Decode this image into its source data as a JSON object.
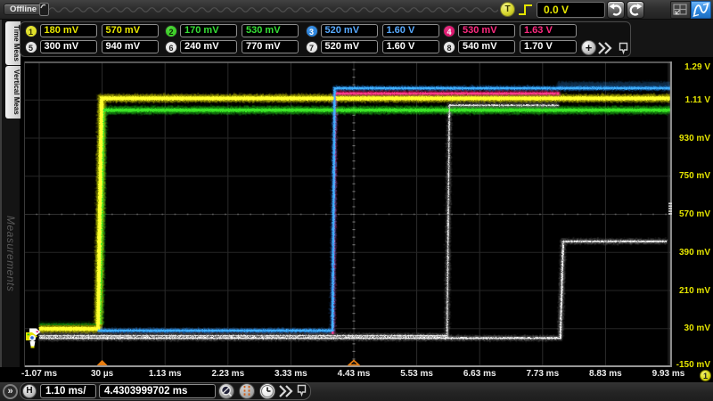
{
  "topbar": {
    "offline_label": "Offline",
    "trigger_letter": "T",
    "trigger_level": "0.0 V"
  },
  "sidebar": {
    "tabs": [
      "Time Meas",
      "Vertical Meas"
    ],
    "watermark": "Measurements"
  },
  "measurements": {
    "rows": [
      [
        {
          "channel": "1",
          "badge_bg": "#e0e02a",
          "badge_fg": "#333300",
          "text_color": "#e8e800",
          "values": [
            "180 mV",
            "570 mV"
          ]
        },
        {
          "channel": "2",
          "badge_bg": "#3fd02a",
          "badge_fg": "#0b2a00",
          "text_color": "#35e035",
          "values": [
            "170 mV",
            "530 mV"
          ]
        },
        {
          "channel": "3",
          "badge_bg": "#2e86dd",
          "badge_fg": "#ffffff",
          "text_color": "#57aaff",
          "values": [
            "520 mV",
            "1.60 V"
          ]
        },
        {
          "channel": "4",
          "badge_bg": "#e01a72",
          "badge_fg": "#ffffff",
          "text_color": "#ff2a80",
          "values": [
            "530 mV",
            "1.63 V"
          ]
        }
      ],
      [
        {
          "channel": "5",
          "badge_bg": "#e6e6e6",
          "badge_fg": "#222222",
          "text_color": "#ffffff",
          "values": [
            "300 mV",
            "940 mV"
          ]
        },
        {
          "channel": "6",
          "badge_bg": "#e6e6e6",
          "badge_fg": "#222222",
          "text_color": "#ffffff",
          "values": [
            "240 mV",
            "770 mV"
          ]
        },
        {
          "channel": "7",
          "badge_bg": "#e6e6e6",
          "badge_fg": "#222222",
          "text_color": "#ffffff",
          "values": [
            "520 mV",
            "1.60 V"
          ]
        },
        {
          "channel": "8",
          "badge_bg": "#e6e6e6",
          "badge_fg": "#222222",
          "text_color": "#ffffff",
          "values": [
            "540 mV",
            "1.70 V"
          ]
        }
      ]
    ],
    "add_label": "+"
  },
  "hbar": {
    "h_label": "H",
    "scale": "1.10 ms/",
    "position": "4.4303999702 ms",
    "expand_glyph": "»"
  },
  "sidebar_expand_glyph": "»",
  "axis_badge": "1",
  "chart_data": {
    "type": "line",
    "title": "",
    "x_unit": "ms",
    "y_unit": "V",
    "x_ticks": [
      "-1.07 ms",
      "30 µs",
      "1.13 ms",
      "2.23 ms",
      "3.33 ms",
      "4.43 ms",
      "5.53 ms",
      "6.63 ms",
      "7.73 ms",
      "8.83 ms",
      "9.93 ms"
    ],
    "x_tick_values": [
      -1.07,
      0.03,
      1.13,
      2.23,
      3.33,
      4.43,
      5.53,
      6.63,
      7.73,
      8.83,
      9.93
    ],
    "y_ticks": [
      "1.29 V",
      "1.11 V",
      "930 mV",
      "750 mV",
      "570 mV",
      "390 mV",
      "210 mV",
      "30 mV",
      "-150 mV"
    ],
    "y_tick_values": [
      1.29,
      1.11,
      0.93,
      0.75,
      0.57,
      0.39,
      0.21,
      0.03,
      -0.15
    ],
    "xlim": [
      -1.07,
      9.93
    ],
    "ylim": [
      -0.15,
      1.29
    ],
    "timebase_marker_time": 0.03,
    "delay_marker_time": 4.43,
    "traces": [
      {
        "name": "channel-2-baseline",
        "color": "#0a4a06",
        "core": "#107c0a",
        "halo_w": 5.5,
        "core_w": 1.4,
        "opacity": 0.5,
        "points": [
          [
            -1.07,
            0.05
          ],
          [
            -0.015,
            0.05
          ]
        ]
      },
      {
        "name": "channel-2",
        "color": "#18a812",
        "core": "#3ae526",
        "halo_w": 8.5,
        "core_w": 3.6,
        "opacity": 0.75,
        "points": [
          [
            -0.015,
            0.05
          ],
          [
            0.045,
            1.062
          ],
          [
            9.97,
            1.062
          ]
        ]
      },
      {
        "name": "channel-1",
        "color": "#b8b800",
        "core": "#ffff2e",
        "halo_w": 8.5,
        "core_w": 4.2,
        "opacity": 0.8,
        "points": [
          [
            -1.07,
            0.029
          ],
          [
            -0.04,
            0.029
          ],
          [
            0.02,
            1.118
          ],
          [
            9.97,
            1.118
          ]
        ]
      },
      {
        "name": "channel-white-a",
        "color": "#808080",
        "core": "#e8e8e8",
        "halo_w": 5.0,
        "core_w": 1.3,
        "opacity": 0.55,
        "points": [
          [
            -1.07,
            -0.004
          ],
          [
            6.06,
            -0.004
          ],
          [
            6.1,
            1.085
          ],
          [
            8.02,
            1.085
          ]
        ]
      },
      {
        "name": "channel-white-b",
        "color": "#848484",
        "core": "#f4f4f4",
        "halo_w": 5.5,
        "core_w": 1.8,
        "opacity": 0.6,
        "points": [
          [
            -1.07,
            -0.015
          ],
          [
            8.04,
            -0.015
          ],
          [
            8.09,
            0.442
          ],
          [
            9.9,
            0.442
          ]
        ]
      },
      {
        "name": "channel-4",
        "color": "#b8104f",
        "core": "#ff3d8e",
        "halo_w": 5.0,
        "core_w": 2.2,
        "opacity": 0.8,
        "points": [
          [
            4.062,
            0.005
          ],
          [
            4.1,
            1.141
          ],
          [
            8.03,
            1.141
          ]
        ]
      },
      {
        "name": "channel-3",
        "color": "#1668b8",
        "core": "#3fb0ff",
        "halo_w": 4.6,
        "core_w": 2.4,
        "opacity": 0.85,
        "points": [
          [
            -0.045,
            0.0206
          ],
          [
            4.058,
            0.0206
          ],
          [
            4.095,
            1.166
          ],
          [
            9.97,
            1.166
          ]
        ]
      },
      {
        "name": "channel-3-fuzz",
        "color": "#2a8fe8",
        "core": "",
        "halo_w": 6.0,
        "core_w": 0,
        "opacity": 0.3,
        "points": [
          [
            7.99,
            1.183
          ],
          [
            9.97,
            1.183
          ]
        ]
      }
    ]
  }
}
